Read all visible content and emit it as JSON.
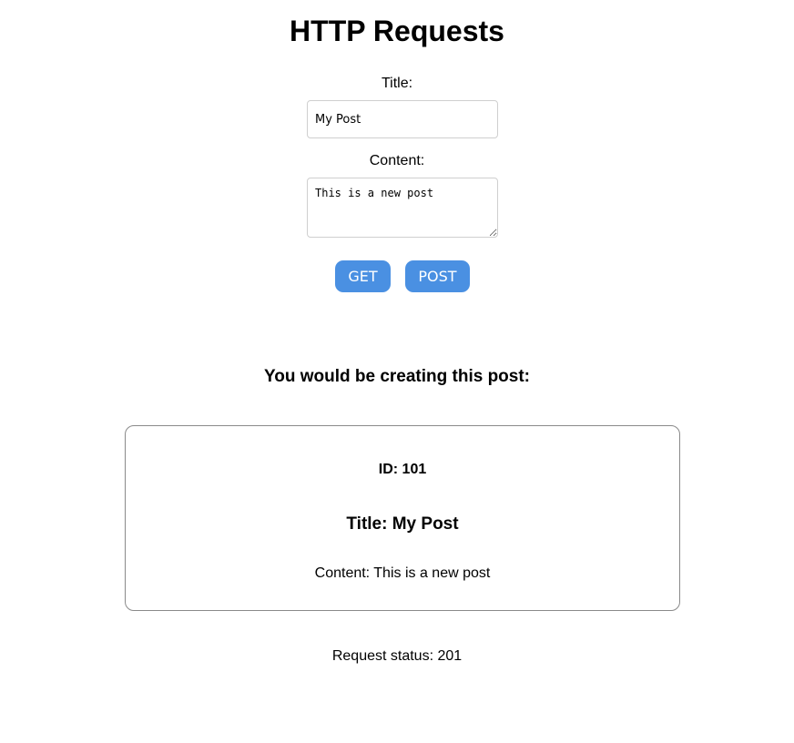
{
  "page": {
    "title": "HTTP Requests"
  },
  "form": {
    "title_label": "Title:",
    "title_value": "My Post",
    "content_label": "Content:",
    "content_value": "This is a new post",
    "get_label": "GET",
    "post_label": "POST"
  },
  "preview": {
    "heading": "You would be creating this post:",
    "id_text": "ID: 101",
    "title_text": "Title: My Post",
    "content_text": "Content: This is a new post"
  },
  "status": {
    "text": "Request status: 201"
  },
  "colors": {
    "button_bg": "#4a90e2",
    "button_text": "#ffffff",
    "card_border": "#8a8a8a",
    "input_border": "#cfcfcf"
  }
}
